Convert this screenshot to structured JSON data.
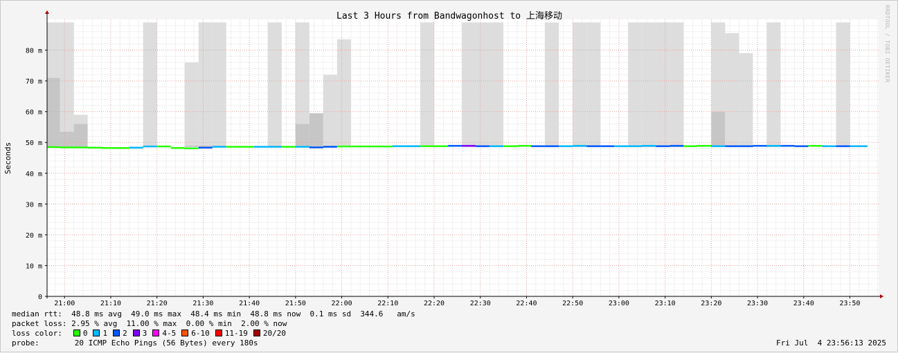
{
  "chart_data": {
    "type": "line",
    "title": "Last 3 Hours from Bandwagonhost to 上海移动",
    "ylabel": "Seconds",
    "ylim": [
      0,
      0.09
    ],
    "y_ticks": [
      {
        "v": 0,
        "label": "0"
      },
      {
        "v": 0.01,
        "label": "10 m"
      },
      {
        "v": 0.02,
        "label": "20 m"
      },
      {
        "v": 0.03,
        "label": "30 m"
      },
      {
        "v": 0.04,
        "label": "40 m"
      },
      {
        "v": 0.05,
        "label": "50 m"
      },
      {
        "v": 0.06,
        "label": "60 m"
      },
      {
        "v": 0.07,
        "label": "70 m"
      },
      {
        "v": 0.08,
        "label": "80 m"
      }
    ],
    "x_range": [
      "20:56:13",
      "23:56:13"
    ],
    "x_ticks": [
      "21:00",
      "21:10",
      "21:20",
      "21:30",
      "21:40",
      "21:50",
      "22:00",
      "22:10",
      "22:20",
      "22:30",
      "22:40",
      "22:50",
      "23:00",
      "23:10",
      "23:20",
      "23:30",
      "23:40",
      "23:50"
    ],
    "grid": true,
    "smoke": [
      {
        "t": "20:56",
        "lo": 0.071,
        "hi": 0.089
      },
      {
        "t": "20:59",
        "lo": 0.0535,
        "hi": 0.089
      },
      {
        "t": "21:02",
        "lo": 0.056,
        "hi": 0.059
      },
      {
        "t": "21:17",
        "lo": 0.049,
        "hi": 0.089
      },
      {
        "t": "21:26",
        "lo": 0.049,
        "hi": 0.076
      },
      {
        "t": "21:29",
        "lo": 0.049,
        "hi": 0.089
      },
      {
        "t": "21:32",
        "lo": 0.049,
        "hi": 0.089
      },
      {
        "t": "21:44",
        "lo": 0.049,
        "hi": 0.089
      },
      {
        "t": "21:50",
        "lo": 0.056,
        "hi": 0.089
      },
      {
        "t": "21:53",
        "lo": 0.0595,
        "hi": 0.0595
      },
      {
        "t": "21:56",
        "lo": 0.049,
        "hi": 0.072
      },
      {
        "t": "21:59",
        "lo": 0.049,
        "hi": 0.0835
      },
      {
        "t": "22:17",
        "lo": 0.049,
        "hi": 0.089
      },
      {
        "t": "22:26",
        "lo": 0.049,
        "hi": 0.089
      },
      {
        "t": "22:29",
        "lo": 0.049,
        "hi": 0.089
      },
      {
        "t": "22:32",
        "lo": 0.049,
        "hi": 0.089
      },
      {
        "t": "22:44",
        "lo": 0.049,
        "hi": 0.089
      },
      {
        "t": "22:50",
        "lo": 0.049,
        "hi": 0.089
      },
      {
        "t": "22:53",
        "lo": 0.049,
        "hi": 0.089
      },
      {
        "t": "23:02",
        "lo": 0.049,
        "hi": 0.089
      },
      {
        "t": "23:05",
        "lo": 0.049,
        "hi": 0.089
      },
      {
        "t": "23:08",
        "lo": 0.049,
        "hi": 0.089
      },
      {
        "t": "23:11",
        "lo": 0.049,
        "hi": 0.089
      },
      {
        "t": "23:20",
        "lo": 0.06,
        "hi": 0.089
      },
      {
        "t": "23:23",
        "lo": 0.049,
        "hi": 0.0855
      },
      {
        "t": "23:26",
        "lo": 0.049,
        "hi": 0.079
      },
      {
        "t": "23:32",
        "lo": 0.049,
        "hi": 0.089
      },
      {
        "t": "23:47",
        "lo": 0.049,
        "hi": 0.089
      }
    ],
    "median": [
      {
        "t": "20:56",
        "v": 0.0485,
        "loss": 0
      },
      {
        "t": "20:59",
        "v": 0.0484,
        "loss": 0
      },
      {
        "t": "21:02",
        "v": 0.0484,
        "loss": 0
      },
      {
        "t": "21:05",
        "v": 0.0483,
        "loss": 0
      },
      {
        "t": "21:08",
        "v": 0.0482,
        "loss": 0
      },
      {
        "t": "21:11",
        "v": 0.0482,
        "loss": 0
      },
      {
        "t": "21:14",
        "v": 0.0483,
        "loss": 1
      },
      {
        "t": "21:17",
        "v": 0.0487,
        "loss": 1
      },
      {
        "t": "21:20",
        "v": 0.0487,
        "loss": 0
      },
      {
        "t": "21:23",
        "v": 0.0482,
        "loss": 0
      },
      {
        "t": "21:26",
        "v": 0.0481,
        "loss": 0
      },
      {
        "t": "21:29",
        "v": 0.0483,
        "loss": 2
      },
      {
        "t": "21:32",
        "v": 0.0486,
        "loss": 1
      },
      {
        "t": "21:35",
        "v": 0.0486,
        "loss": 0
      },
      {
        "t": "21:38",
        "v": 0.0486,
        "loss": 0
      },
      {
        "t": "21:41",
        "v": 0.0486,
        "loss": 1
      },
      {
        "t": "21:44",
        "v": 0.0486,
        "loss": 1
      },
      {
        "t": "21:47",
        "v": 0.0486,
        "loss": 0
      },
      {
        "t": "21:50",
        "v": 0.0486,
        "loss": 1
      },
      {
        "t": "21:53",
        "v": 0.0484,
        "loss": 2
      },
      {
        "t": "21:56",
        "v": 0.0486,
        "loss": 2
      },
      {
        "t": "21:59",
        "v": 0.0487,
        "loss": 0
      },
      {
        "t": "22:02",
        "v": 0.0487,
        "loss": 0
      },
      {
        "t": "22:05",
        "v": 0.0487,
        "loss": 0
      },
      {
        "t": "22:08",
        "v": 0.0487,
        "loss": 0
      },
      {
        "t": "22:11",
        "v": 0.0488,
        "loss": 1
      },
      {
        "t": "22:14",
        "v": 0.0488,
        "loss": 1
      },
      {
        "t": "22:17",
        "v": 0.0488,
        "loss": 0
      },
      {
        "t": "22:20",
        "v": 0.0488,
        "loss": 0
      },
      {
        "t": "22:23",
        "v": 0.0489,
        "loss": 2
      },
      {
        "t": "22:26",
        "v": 0.0489,
        "loss": 3
      },
      {
        "t": "22:29",
        "v": 0.0488,
        "loss": 2
      },
      {
        "t": "22:32",
        "v": 0.0488,
        "loss": 1
      },
      {
        "t": "22:35",
        "v": 0.0488,
        "loss": 0
      },
      {
        "t": "22:38",
        "v": 0.0489,
        "loss": 0
      },
      {
        "t": "22:41",
        "v": 0.0488,
        "loss": 2
      },
      {
        "t": "22:44",
        "v": 0.0488,
        "loss": 2
      },
      {
        "t": "22:47",
        "v": 0.0488,
        "loss": 1
      },
      {
        "t": "22:50",
        "v": 0.0489,
        "loss": 1
      },
      {
        "t": "22:53",
        "v": 0.0488,
        "loss": 2
      },
      {
        "t": "22:56",
        "v": 0.0488,
        "loss": 2
      },
      {
        "t": "22:59",
        "v": 0.0488,
        "loss": 1
      },
      {
        "t": "23:02",
        "v": 0.0488,
        "loss": 1
      },
      {
        "t": "23:05",
        "v": 0.0489,
        "loss": 1
      },
      {
        "t": "23:08",
        "v": 0.0488,
        "loss": 2
      },
      {
        "t": "23:11",
        "v": 0.0489,
        "loss": 2
      },
      {
        "t": "23:14",
        "v": 0.0488,
        "loss": 0
      },
      {
        "t": "23:17",
        "v": 0.0489,
        "loss": 0
      },
      {
        "t": "23:20",
        "v": 0.0488,
        "loss": 1
      },
      {
        "t": "23:23",
        "v": 0.0488,
        "loss": 2
      },
      {
        "t": "23:26",
        "v": 0.0488,
        "loss": 2
      },
      {
        "t": "23:29",
        "v": 0.0489,
        "loss": 2
      },
      {
        "t": "23:32",
        "v": 0.0489,
        "loss": 1
      },
      {
        "t": "23:35",
        "v": 0.0489,
        "loss": 2
      },
      {
        "t": "23:38",
        "v": 0.0488,
        "loss": 2
      },
      {
        "t": "23:41",
        "v": 0.0489,
        "loss": 0
      },
      {
        "t": "23:44",
        "v": 0.0488,
        "loss": 1
      },
      {
        "t": "23:47",
        "v": 0.0488,
        "loss": 2
      },
      {
        "t": "23:50",
        "v": 0.0488,
        "loss": 1
      },
      {
        "t": "23:53",
        "v": 0.0488,
        "loss": 1
      }
    ]
  },
  "colors": {
    "loss_0": "#26ff00",
    "loss_1": "#00b8ff",
    "loss_2": "#0059ff",
    "loss_3": "#7e00ff",
    "loss_4_5": "#ff00ff",
    "loss_6_10": "#ff5500",
    "loss_11_19": "#ff0000",
    "loss_20": "#a10000",
    "smoke_light": "#dddddd",
    "smoke_dark": "#c6c6c6"
  },
  "stats": {
    "median_rtt": "median rtt:  48.8 ms avg  49.0 ms max  48.4 ms min  48.8 ms now  0.1 ms sd  344.6   am/s",
    "packet_loss": "packet loss: 2.95 % avg  11.00 % max  0.00 % min  2.00 % now",
    "loss_color_label": "loss color:",
    "loss_legend": [
      {
        "label": "0",
        "color": "#26ff00"
      },
      {
        "label": "1",
        "color": "#00b8ff"
      },
      {
        "label": "2",
        "color": "#0059ff"
      },
      {
        "label": "3",
        "color": "#7e00ff"
      },
      {
        "label": "4-5",
        "color": "#ff00ff"
      },
      {
        "label": "6-10",
        "color": "#ff5500"
      },
      {
        "label": "11-19",
        "color": "#ff0000"
      },
      {
        "label": "20/20",
        "color": "#a10000"
      }
    ],
    "probe_label": "probe:",
    "probe_text": "20 ICMP Echo Pings (56 Bytes) every 180s",
    "date": "Fri Jul  4 23:56:13 2025"
  },
  "side_label": "RRDTOOL / TOBI OETIKER"
}
